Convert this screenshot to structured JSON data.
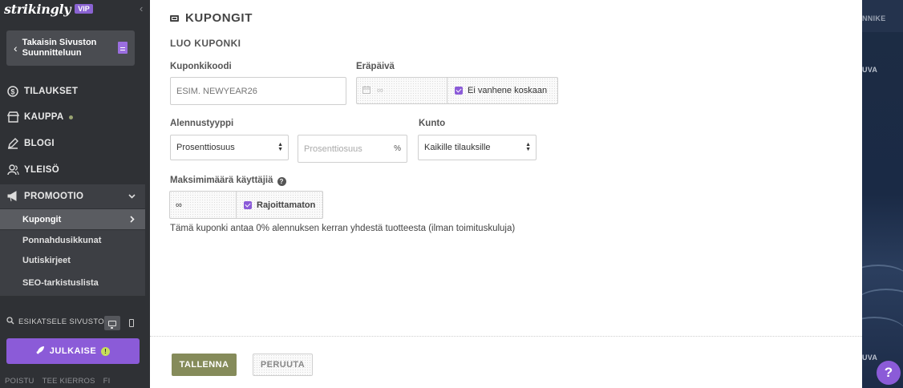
{
  "sidebar": {
    "logo": "strikingly",
    "vip_badge": "VIP",
    "back_button": "Takaisin Sivuston Suunnitteluun",
    "nav": [
      {
        "label": "TILAUKSET",
        "icon": "dollar-icon"
      },
      {
        "label": "KAUPPA",
        "icon": "store-icon"
      },
      {
        "label": "BLOGI",
        "icon": "pen-icon"
      },
      {
        "label": "YLEISÖ",
        "icon": "users-icon"
      },
      {
        "label": "PROMOOTIO",
        "icon": "megaphone-icon"
      }
    ],
    "promo_sub": [
      {
        "label": "Kupongit"
      },
      {
        "label": "Ponnahdusikkunat"
      },
      {
        "label": "Uutiskirjeet"
      },
      {
        "label": "SEO-tarkistuslista"
      }
    ],
    "preview_label": "ESIKATSELE SIVUSTO",
    "publish_label": "JULKAISE",
    "publish_alert": "!",
    "footer": [
      "POISTU",
      "TEE KIERROS",
      "FI"
    ]
  },
  "background": {
    "label_top": "NNIKE",
    "label_mid": "UVA",
    "label_bottom": "UVA"
  },
  "help_label": "?",
  "main": {
    "title": "KUPONGIT",
    "subtitle": "LUO KUPONKI",
    "code": {
      "label": "Kuponkikoodi",
      "placeholder": "ESIM. NEWYEAR26"
    },
    "expiry": {
      "label": "Eräpäivä",
      "value": "∞",
      "checkbox": "Ei vanhene koskaan"
    },
    "discount_type": {
      "label": "Alennustyyppi",
      "selected": "Prosenttiosuus"
    },
    "discount_value": {
      "placeholder": "Prosenttiosuus",
      "unit": "%"
    },
    "condition": {
      "label": "Kunto",
      "selected": "Kaikille tilauksille"
    },
    "max_uses": {
      "label": "Maksimimäärä käyttäjiä",
      "value": "∞",
      "checkbox": "Rajoittamaton"
    },
    "description": "Tämä kuponki antaa 0% alennuksen kerran yhdestä tuotteesta (ilman toimituskuluja)",
    "save_label": "TALLENNA",
    "cancel_label": "PERUUTA"
  },
  "colors": {
    "sidebar": "#2f3135",
    "accent_purple": "#8b5bd8",
    "save_olive": "#858b5a"
  }
}
